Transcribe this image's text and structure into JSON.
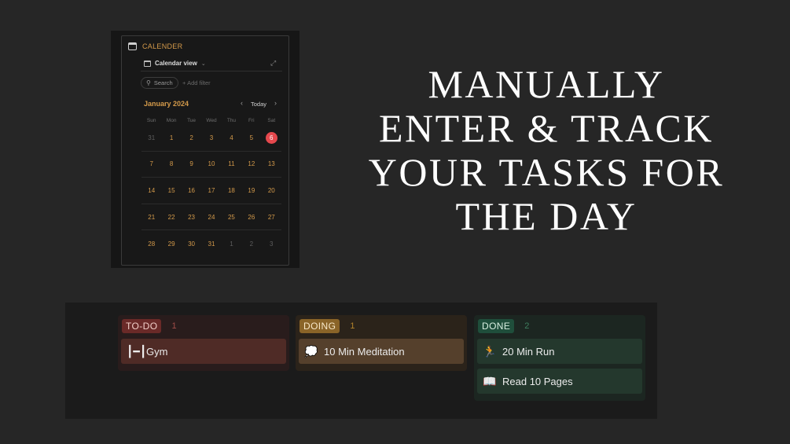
{
  "calendar": {
    "title": "CALENDER",
    "view_label": "Calendar view",
    "search_label": "Search",
    "add_filter_label": "Add filter",
    "month_label": "January 2024",
    "today_label": "Today",
    "weekdays": [
      "Sun",
      "Mon",
      "Tue",
      "Wed",
      "Thu",
      "Fri",
      "Sat"
    ],
    "weeks": [
      [
        "31",
        "1",
        "2",
        "3",
        "4",
        "5",
        "6"
      ],
      [
        "7",
        "8",
        "9",
        "10",
        "11",
        "12",
        "13"
      ],
      [
        "14",
        "15",
        "16",
        "17",
        "18",
        "19",
        "20"
      ],
      [
        "21",
        "22",
        "23",
        "24",
        "25",
        "26",
        "27"
      ],
      [
        "28",
        "29",
        "30",
        "31",
        "1",
        "2",
        "3"
      ]
    ],
    "today": "6",
    "accent_color": "#d49a4a",
    "today_color": "#e5484d"
  },
  "headline": {
    "lines": [
      "MANUALLY",
      "ENTER & TRACK",
      "YOUR TASKS FOR",
      "THE DAY"
    ]
  },
  "board": {
    "columns": [
      {
        "tag": "TO-DO",
        "count": "1",
        "color": "#6a2a28",
        "cards": [
          {
            "icon": "dumbbell-icon",
            "label": "Gym"
          }
        ]
      },
      {
        "tag": "DOING",
        "count": "1",
        "color": "#8a6428",
        "cards": [
          {
            "icon": "thought-bubble-icon",
            "label": "10 Min Meditation"
          }
        ]
      },
      {
        "tag": "DONE",
        "count": "2",
        "color": "#1f4e3b",
        "cards": [
          {
            "icon": "running-person-icon",
            "label": "20 Min Run"
          },
          {
            "icon": "open-book-icon",
            "label": "Read 10 Pages"
          }
        ]
      }
    ]
  }
}
